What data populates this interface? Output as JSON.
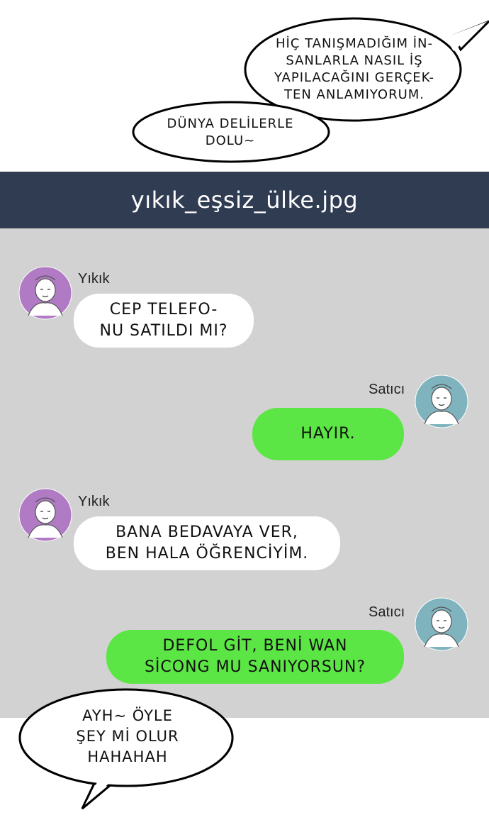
{
  "top_bubbles": {
    "bubble1": "HİÇ TANIŞMADIĞIM İN-\nSANLARLA NASIL İŞ\nYAPILACAĞINI GERÇEK-\nTEN ANLAMIYORUM.",
    "bubble2": "DÜNYA DELİLERLE\nDOLU~"
  },
  "header": {
    "title": "yıkık_eşsiz_ülke.jpg"
  },
  "chat": {
    "messages": [
      {
        "sender": "Yıkık",
        "text": "CEP TELEFO-\nNU SATILDI MI?"
      },
      {
        "sender": "Satıcı",
        "text": "HAYIR."
      },
      {
        "sender": "Yıkık",
        "text": "BANA BEDAVAYA VER,\nBEN HALA ÖĞRENCİYİM."
      },
      {
        "sender": "Satıcı",
        "text": "DEFOL GİT, BENİ WAN\nSİCONG MU SANIYORSUN?"
      }
    ]
  },
  "bottom_bubble": {
    "text": "AYH~ ÖYLE\nŞEY Mİ OLUR\nHAHAHAH"
  },
  "colors": {
    "header_bg": "#2f3c51",
    "chat_bg": "#d2d2d2",
    "outgoing_bubble": "#5ce645",
    "incoming_bubble": "#ffffff",
    "avatar_yikik": "#b07ac4",
    "avatar_satici": "#7fb4bf"
  },
  "icons": {
    "yikik_avatar": "person-avatar-icon",
    "satici_avatar": "person-avatar-icon"
  }
}
